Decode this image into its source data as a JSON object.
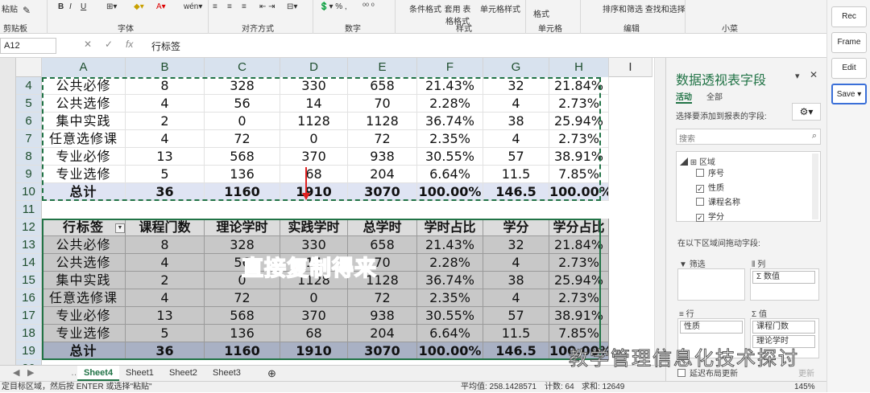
{
  "ribbon": {
    "groups": [
      "剪贴板",
      "字体",
      "对齐方式",
      "数字",
      "样式",
      "单元格",
      "编辑",
      "小菜"
    ],
    "paste": "粘贴",
    "font_buttons": [
      "B",
      "I",
      "U"
    ],
    "cond_format": "条件格式",
    "table_format": "套用 表格格式",
    "cell_style": "单元格样式",
    "format": "格式",
    "sort_find": "排序和筛选 查找和选择"
  },
  "formula_bar": {
    "name_box": "A12",
    "fx": "fx",
    "formula": "行标签"
  },
  "columns": [
    "A",
    "B",
    "C",
    "D",
    "E",
    "F",
    "G",
    "H",
    "I"
  ],
  "source_rows": [
    {
      "num": "4",
      "cells": [
        "公共必修",
        "8",
        "328",
        "330",
        "658",
        "21.43%",
        "32",
        "21.84%"
      ]
    },
    {
      "num": "5",
      "cells": [
        "公共选修",
        "4",
        "56",
        "14",
        "70",
        "2.28%",
        "4",
        "2.73%"
      ]
    },
    {
      "num": "6",
      "cells": [
        "集中实践",
        "2",
        "0",
        "1128",
        "1128",
        "36.74%",
        "38",
        "25.94%"
      ]
    },
    {
      "num": "7",
      "cells": [
        "任意选修课",
        "4",
        "72",
        "0",
        "72",
        "2.35%",
        "4",
        "2.73%"
      ]
    },
    {
      "num": "8",
      "cells": [
        "专业必修",
        "13",
        "568",
        "370",
        "938",
        "30.55%",
        "57",
        "38.91%"
      ]
    },
    {
      "num": "9",
      "cells": [
        "专业选修",
        "5",
        "136",
        "68",
        "204",
        "6.64%",
        "11.5",
        "7.85%"
      ]
    },
    {
      "num": "10",
      "cells": [
        "总计",
        "36",
        "1160",
        "1910",
        "3070",
        "100.00%",
        "146.5",
        "100.00%"
      ]
    }
  ],
  "empty_row": "11",
  "pivot_header": {
    "num": "12",
    "cells": [
      "行标签",
      "课程门数",
      "理论学时",
      "实践学时",
      "总学时",
      "学时占比",
      "学分",
      "学分占比"
    ]
  },
  "pivot_rows": [
    {
      "num": "13",
      "cells": [
        "公共必修",
        "8",
        "328",
        "330",
        "658",
        "21.43%",
        "32",
        "21.84%"
      ]
    },
    {
      "num": "14",
      "cells": [
        "公共选修",
        "4",
        "56",
        "14",
        "70",
        "2.28%",
        "4",
        "2.73%"
      ]
    },
    {
      "num": "15",
      "cells": [
        "集中实践",
        "2",
        "0",
        "1128",
        "1128",
        "36.74%",
        "38",
        "25.94%"
      ]
    },
    {
      "num": "16",
      "cells": [
        "任意选修课",
        "4",
        "72",
        "0",
        "72",
        "2.35%",
        "4",
        "2.73%"
      ]
    },
    {
      "num": "17",
      "cells": [
        "专业必修",
        "13",
        "568",
        "370",
        "938",
        "30.55%",
        "57",
        "38.91%"
      ]
    },
    {
      "num": "18",
      "cells": [
        "专业选修",
        "5",
        "136",
        "68",
        "204",
        "6.64%",
        "11.5",
        "7.85%"
      ]
    },
    {
      "num": "19",
      "cells": [
        "总计",
        "36",
        "1160",
        "1910",
        "3070",
        "100.00%",
        "146.5",
        "100.00%"
      ]
    }
  ],
  "partial_row": "20",
  "overlay_text": "直接复制得来",
  "sheet_tabs": [
    "Sheet4",
    "Sheet1",
    "Sheet2",
    "Sheet3"
  ],
  "active_tab": "Sheet4",
  "status": {
    "message": "定目标区域，然后按 ENTER 或选择\"粘贴\"",
    "average": "平均值: 258.1428571",
    "count": "计数: 64",
    "sum": "求和: 12649",
    "zoom": "145%"
  },
  "pivot_pane": {
    "title": "数据透视表字段",
    "tab_active": "活动",
    "tab_all": "全部",
    "choose_label": "选择要添加到报表的字段:",
    "search_placeholder": "搜索",
    "area_group": "区域",
    "fields": [
      {
        "label": "序号",
        "checked": false
      },
      {
        "label": "性质",
        "checked": true
      },
      {
        "label": "课程名称",
        "checked": false
      },
      {
        "label": "学分",
        "checked": true
      }
    ],
    "drag_label": "在以下区域间拖动字段:",
    "filter": "筛选",
    "columns": "列",
    "rows": "行",
    "values": "值",
    "col_chip": "Σ 数值",
    "row_chip": "性质",
    "value_chips": [
      "课程门数",
      "理论学时"
    ],
    "defer": "延迟布局更新",
    "update": "更新"
  },
  "side_buttons": [
    "Rec",
    "Frame",
    "Edit",
    "Save"
  ],
  "watermark": "教学管理信息化技术探讨",
  "colors": {
    "excel_green": "#217346",
    "arrow_red": "#e02020",
    "pivot_gray": "#c8c8c8"
  }
}
